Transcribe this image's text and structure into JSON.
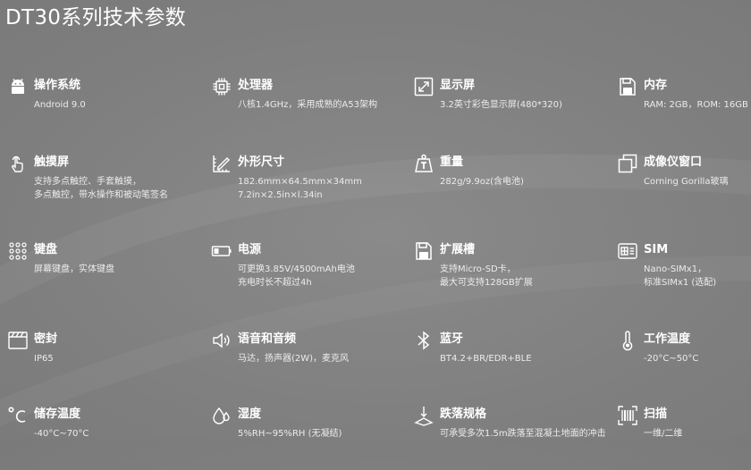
{
  "page": {
    "title": "DT30系列技术参数"
  },
  "specs": [
    {
      "icon": "android-icon",
      "title": "操作系统",
      "lines": [
        "Android 9.0"
      ]
    },
    {
      "icon": "processor-icon",
      "title": "处理器",
      "lines": [
        "八核1.4GHz，采用成熟的A53架构"
      ]
    },
    {
      "icon": "display-icon",
      "title": "显示屏",
      "lines": [
        "3.2英寸彩色显示屏(480*320)"
      ]
    },
    {
      "icon": "memory-icon",
      "title": "内存",
      "lines": [
        "RAM: 2GB，ROM: 16GB"
      ]
    },
    {
      "icon": "touch-icon",
      "title": "触摸屏",
      "lines": [
        "支持多点触控、手套触摸，",
        "多点触控，带水操作和被动笔签名"
      ]
    },
    {
      "icon": "dimensions-icon",
      "title": "外形尺寸",
      "lines": [
        "182.6mm×64.5mm×34mm",
        "7.2in×2.5in×l.34in"
      ]
    },
    {
      "icon": "weight-icon",
      "title": "重量",
      "lines": [
        "282g/9.9oz(含电池)"
      ]
    },
    {
      "icon": "window-icon",
      "title": "成像仪窗口",
      "lines": [
        "Corning Gorilla玻璃"
      ]
    },
    {
      "icon": "keypad-icon",
      "title": "键盘",
      "lines": [
        "屏幕键盘，实体键盘"
      ]
    },
    {
      "icon": "battery-icon",
      "title": "电源",
      "lines": [
        "可更换3.85V/4500mAh电池",
        "充电时长不超过4h"
      ]
    },
    {
      "icon": "sd-card-icon",
      "title": "扩展槽",
      "lines": [
        "支持Micro-SD卡，",
        "最大可支持128GB扩展"
      ]
    },
    {
      "icon": "sim-icon",
      "title": "SIM",
      "lines": [
        "Nano-SIMx1，",
        "标准SIMx1 (选配)"
      ]
    },
    {
      "icon": "seal-icon",
      "title": "密封",
      "lines": [
        "IP65"
      ]
    },
    {
      "icon": "speaker-icon",
      "title": "语音和音频",
      "lines": [
        "马达，扬声器(2W)，麦克风"
      ]
    },
    {
      "icon": "bluetooth-icon",
      "title": "蓝牙",
      "lines": [
        "BT4.2+BR/EDR+BLE"
      ]
    },
    {
      "icon": "thermometer-icon",
      "title": "工作温度",
      "lines": [
        "-20°C~50°C"
      ]
    },
    {
      "icon": "celsius-icon",
      "title": "储存温度",
      "lines": [
        "-40°C~70°C"
      ]
    },
    {
      "icon": "humidity-icon",
      "title": "湿度",
      "lines": [
        "5%RH~95%RH (无凝结)"
      ]
    },
    {
      "icon": "drop-test-icon",
      "title": "跌落规格",
      "lines": [
        "可承受多次1.5m跌落至混凝土地面的冲击"
      ]
    },
    {
      "icon": "barcode-scan-icon",
      "title": "扫描",
      "lines": [
        "一维/二维"
      ]
    }
  ]
}
